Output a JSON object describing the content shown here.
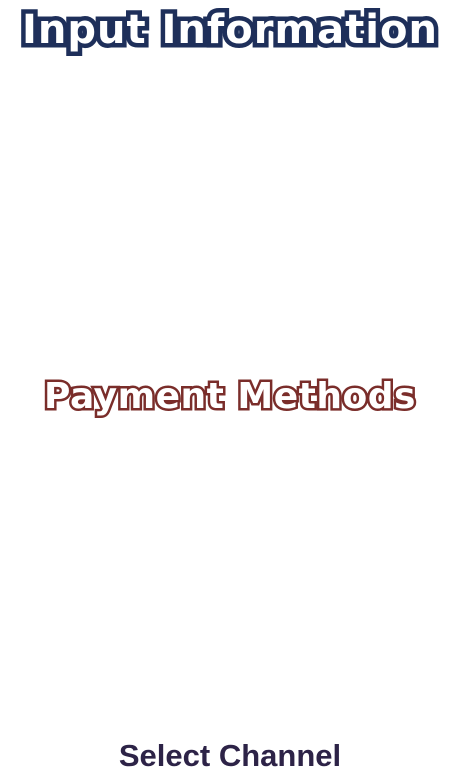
{
  "header": {
    "title": "Input Information",
    "fill_color": "#ffffff",
    "outline_color": "#1e2f5a"
  },
  "section": {
    "title": "Payment Methods",
    "fill_color": "#ffffff",
    "outline_color": "#7a2d2a"
  },
  "footer": {
    "label": "Select Channel",
    "color": "#2d2347"
  }
}
